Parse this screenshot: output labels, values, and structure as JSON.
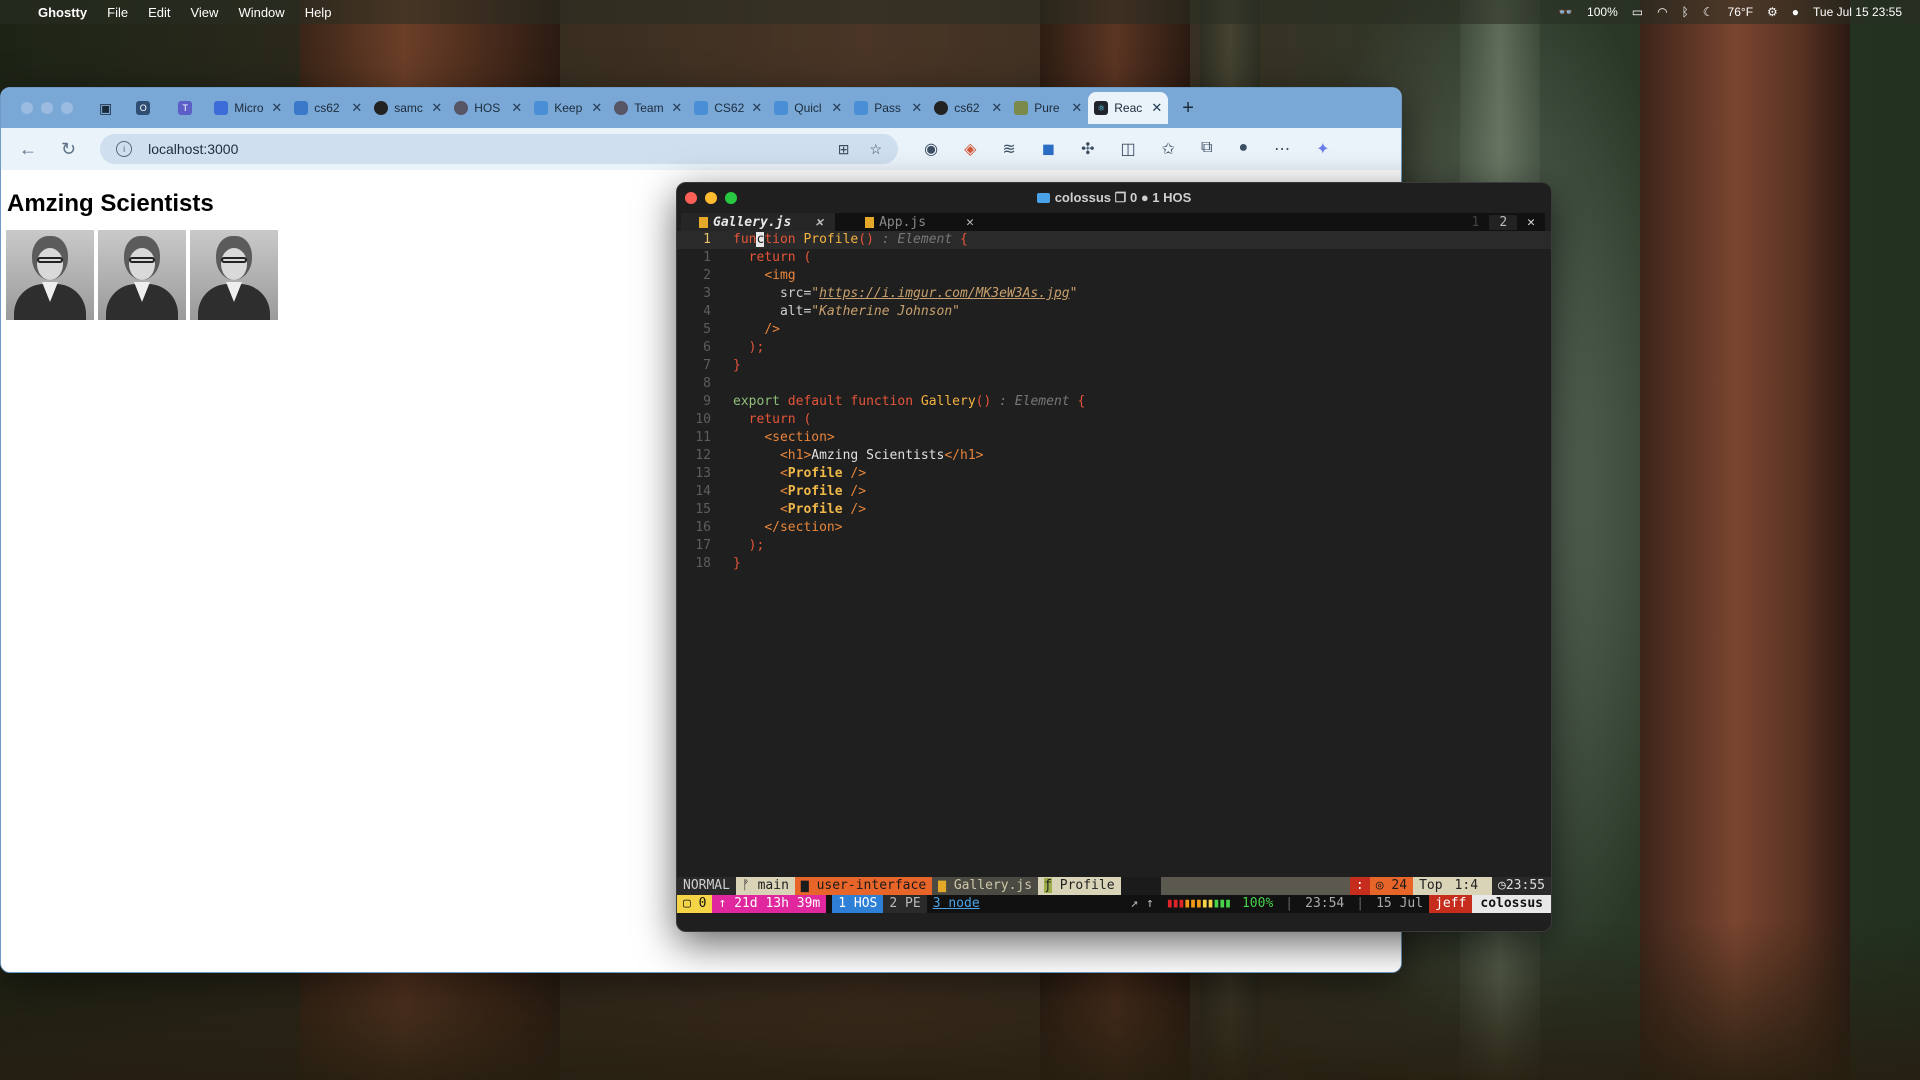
{
  "menubar": {
    "app": "Ghostty",
    "items": [
      "File",
      "Edit",
      "View",
      "Window",
      "Help"
    ],
    "battery": "100%",
    "weather": "76°F",
    "datetime": "Tue Jul 15  23:55"
  },
  "browser": {
    "tabs": [
      {
        "label": "Micro"
      },
      {
        "label": "cs62"
      },
      {
        "label": "samc"
      },
      {
        "label": "HOS"
      },
      {
        "label": "Keep"
      },
      {
        "label": "Team"
      },
      {
        "label": "CS62"
      },
      {
        "label": "Quicl"
      },
      {
        "label": "Pass"
      },
      {
        "label": "cs62"
      },
      {
        "label": "Pure"
      },
      {
        "label": "Reac"
      }
    ],
    "url": "localhost:3000",
    "page_heading": "Amzing Scientists",
    "photo_alt": "Katherine Johnson"
  },
  "terminal": {
    "title": "colossus",
    "title_extra": "0",
    "session": "1 HOS",
    "buffers": [
      {
        "name": "Gallery.js",
        "close": "✕"
      },
      {
        "name": "App.js",
        "close": "✕"
      }
    ],
    "buffer_right": [
      "1",
      "2",
      "✕"
    ],
    "line_numbers": [
      "1",
      "1",
      "2",
      "3",
      "4",
      "5",
      "6",
      "7",
      "8",
      "9",
      "10",
      "11",
      "12",
      "13",
      "14",
      "15",
      "16",
      "17",
      "18"
    ],
    "code": {
      "l0_kw1": "fun",
      "l0_cursor": "c",
      "l0_kw2": "tion",
      "fn1": "Profile",
      "parens": "()",
      "type": ": Element",
      "brace_open": "{",
      "return": "return",
      "paren_open": "(",
      "img_tag": "<img",
      "src_attr": "src=",
      "url": "https://i.imgur.com/MK3eW3As.jpg",
      "alt_attr": "alt=",
      "alt_val": "\"Katherine Johnson\"",
      "self_close": "/>",
      "paren_close": ");",
      "brace_close": "}",
      "export": "export",
      "default": "default",
      "function": "function",
      "fn2": "Gallery",
      "section_open": "<section>",
      "h1_open": "<h1>",
      "h1_text": "Amzing Scientists",
      "h1_close": "</h1>",
      "lt": "<",
      "profile": "Profile",
      "sc": " />",
      "section_close": "</section>"
    },
    "status": {
      "mode": "NORMAL",
      "branch": "main",
      "dir": "user-interface",
      "file": "Gallery.js",
      "func": "Profile",
      "diag_count": "24",
      "position_label": "Top",
      "position": "1:4",
      "clock": "23:55"
    },
    "tmux": {
      "win0": "0",
      "uptime": "21d 13h 39m",
      "win1": "1 HOS",
      "win2": "2 PE",
      "win3": "3 node",
      "battery": "100%",
      "time": "23:54",
      "date": "15 Jul",
      "user": "jeff",
      "host": "colossus"
    }
  },
  "colors": {
    "accent_tabbar": "#7aa8d6",
    "status_yellow": "#f5d547",
    "status_magenta": "#e0279e",
    "status_blue": "#2e7fd6",
    "status_orange": "#e8652a"
  }
}
